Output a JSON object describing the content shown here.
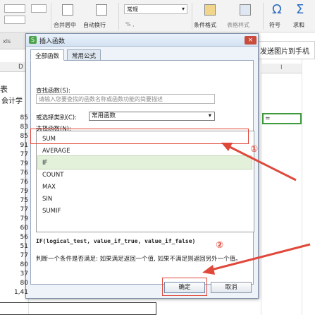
{
  "ribbon": {
    "merge_center": "合并居中",
    "auto_wrap": "自动换行",
    "number_format": "常规",
    "percent_group": "% ,",
    "cond_format": "条件格式",
    "table_style": "表格样式",
    "symbol": "符号",
    "sum": "求和",
    "symbol_glyph": "Ω",
    "sum_glyph": "Σ"
  },
  "file_tab": "xls",
  "send_bar": "发送图片到手机",
  "column_header": "I",
  "cell_text": "=",
  "sheet": {
    "col_header_d": "D",
    "title_fragment": "表",
    "title_fragment2": "会计学",
    "values": [
      "85",
      "83",
      "85",
      "91",
      "77",
      "79",
      "76",
      "76",
      "79",
      "75",
      "77",
      "79",
      "60",
      "56",
      "51",
      "77",
      "80",
      "37",
      "80",
      "1,41"
    ]
  },
  "dialog": {
    "title": "插入函数",
    "close": "×",
    "tabs": [
      "全部函数",
      "常用公式"
    ],
    "search_label": "查找函数(S):",
    "search_placeholder": "请输入您要查找的函数名称或函数功能的简要描述",
    "category_label": "或选择类别(C):",
    "category_value": "常用函数",
    "list_label": "选择函数(N):",
    "functions": [
      "SUM",
      "AVERAGE",
      "IF",
      "COUNT",
      "MAX",
      "SIN",
      "SUMIF"
    ],
    "selected_function": "IF",
    "syntax": "IF(logical_test, value_if_true, value_if_false)",
    "description": "判断一个条件是否满足: 如果满足返回一个值, 如果不满足则返回另外一个值。",
    "ok": "确定",
    "cancel": "取消"
  },
  "annotations": {
    "step1": "①",
    "step2": "②",
    "color": "#e0483a"
  }
}
